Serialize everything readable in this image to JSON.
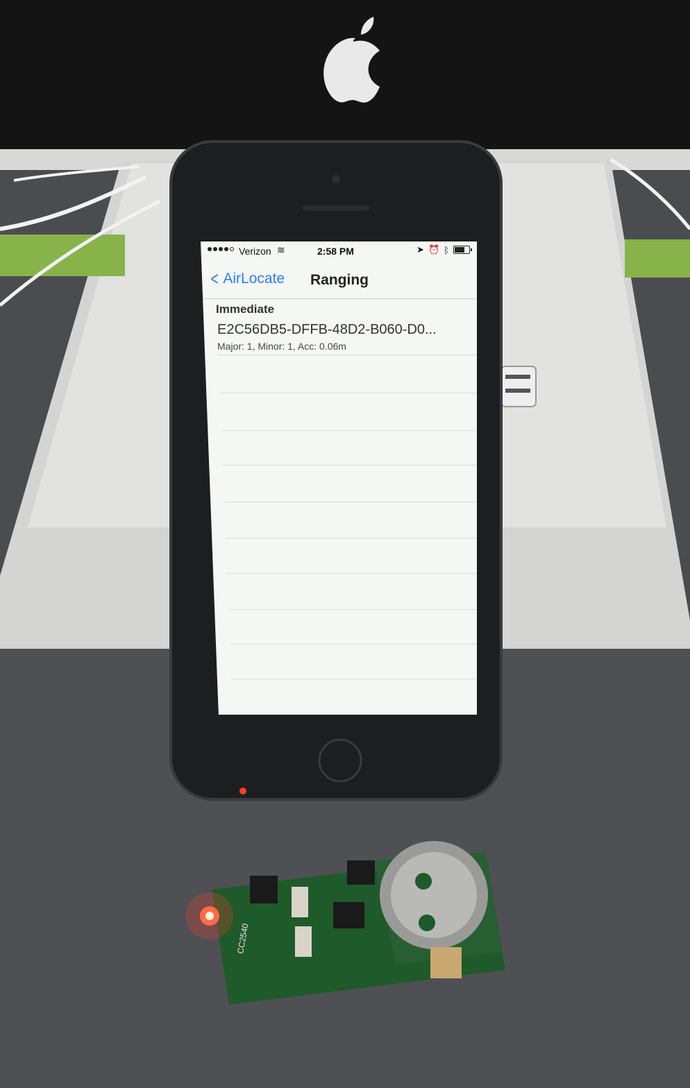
{
  "status_bar": {
    "carrier": "Verizon",
    "time": "2:58 PM",
    "battery_level": 0.7
  },
  "nav": {
    "back_label": "AirLocate",
    "title": "Ranging"
  },
  "section_header": "Immediate",
  "beacon": {
    "uuid": "E2C56DB5-DFFB-48D2-B060-D0...",
    "details": "Major: 1, Minor: 1, Acc: 0.06m"
  },
  "colors": {
    "ios_blue": "#2f7de6",
    "screen_bg": "#f4f7f3",
    "phone_body": "#1d1e20",
    "led": "#ff3a2a",
    "pcb_green": "#1f5a2a"
  },
  "icons": [
    "wifi-icon",
    "location-arrow-icon",
    "alarm-icon",
    "bluetooth-icon",
    "battery-icon",
    "chevron-left-icon",
    "apple-logo-icon"
  ]
}
